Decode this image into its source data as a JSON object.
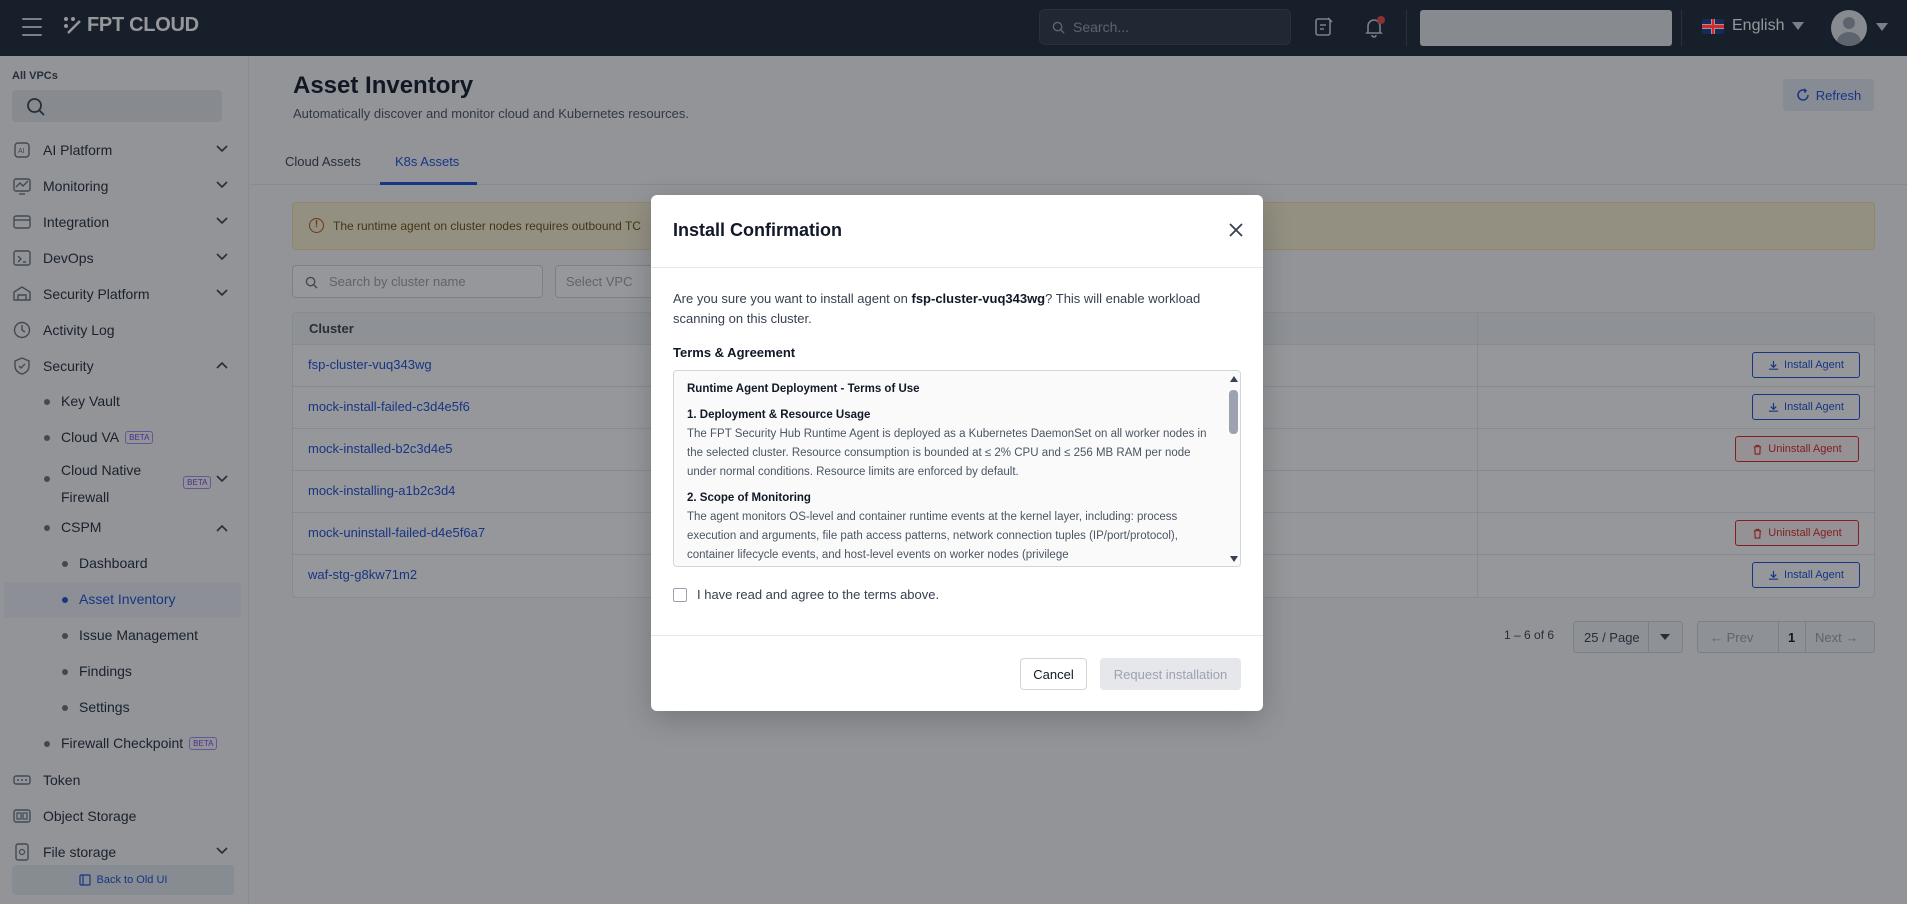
{
  "topbar": {
    "brand": "FPT CLOUD",
    "search_placeholder": "Search...",
    "language": "English"
  },
  "sidebar": {
    "vpc_label": "All VPCs",
    "items": [
      {
        "label": "AI Platform",
        "icon": "ai-icon"
      },
      {
        "label": "Monitoring",
        "icon": "monitoring-icon"
      },
      {
        "label": "Integration",
        "icon": "integration-icon"
      },
      {
        "label": "DevOps",
        "icon": "devops-icon"
      },
      {
        "label": "Security Platform",
        "icon": "security-platform-icon"
      },
      {
        "label": "Activity Log",
        "icon": "activity-log-icon"
      },
      {
        "label": "Security",
        "icon": "shield-icon"
      }
    ],
    "security_sub": {
      "key_vault": "Key Vault",
      "cloud_va": "Cloud VA",
      "cnf_line1": "Cloud Native",
      "cnf_line2": "Firewall",
      "cspm": "CSPM",
      "dashboard": "Dashboard",
      "asset_inventory": "Asset Inventory",
      "issue_management": "Issue Management",
      "findings": "Findings",
      "settings": "Settings",
      "firewall_checkpoint": "Firewall Checkpoint",
      "beta": "BETA"
    },
    "bottom_items": {
      "token": "Token",
      "object_storage": "Object Storage",
      "file_storage": "File storage"
    },
    "back_old_ui": "Back to Old UI"
  },
  "page": {
    "title": "Asset Inventory",
    "subtitle": "Automatically discover and monitor cloud and Kubernetes resources.",
    "refresh": "Refresh",
    "tabs": [
      "Cloud Assets",
      "K8s Assets"
    ],
    "alert_text": "The runtime agent on cluster nodes requires outbound TC",
    "cluster_search_placeholder": "Search by cluster name",
    "vpc_select_placeholder": "Select VPC",
    "table_header_cluster": "Cluster",
    "rows": [
      {
        "name": "fsp-cluster-vuq343wg",
        "action": "Install Agent"
      },
      {
        "name": "mock-install-failed-c3d4e5f6",
        "action": "Install Agent"
      },
      {
        "name": "mock-installed-b2c3d4e5",
        "action": "Uninstall Agent"
      },
      {
        "name": "mock-installing-a1b2c3d4",
        "action": ""
      },
      {
        "name": "mock-uninstall-failed-d4e5f6a7",
        "action": "Uninstall Agent"
      },
      {
        "name": "waf-stg-g8kw71m2",
        "action": "Install Agent"
      }
    ],
    "pagination": {
      "range": "1 – 6 of 6",
      "per_page": "25 / Page",
      "prev": "Prev",
      "current": "1",
      "next": "Next"
    }
  },
  "modal": {
    "title": "Install Confirmation",
    "question_pre": "Are you sure you want to install agent on ",
    "cluster": "fsp-cluster-vuq343wg",
    "question_post": "? This will enable workload scanning on this cluster.",
    "terms_title": "Terms & Agreement",
    "terms_heading": "Runtime Agent Deployment - Terms of Use",
    "section1_title": "1. Deployment & Resource Usage",
    "section1_body": "The FPT Security Hub Runtime Agent is deployed as a Kubernetes DaemonSet on all worker nodes in the selected cluster. Resource consumption is bounded at ≤ 2% CPU and ≤ 256 MB RAM per node under normal conditions. Resource limits are enforced by default.",
    "section2_title": "2. Scope of Monitoring",
    "section2_body": "The agent monitors OS-level and container runtime events at the kernel layer, including: process execution and arguments, file path access patterns, network connection tuples (IP/port/protocol), container lifecycle events, and host-level events on worker nodes (privilege",
    "agree_label": "I have read and agree to the terms above.",
    "cancel": "Cancel",
    "request": "Request installation"
  }
}
